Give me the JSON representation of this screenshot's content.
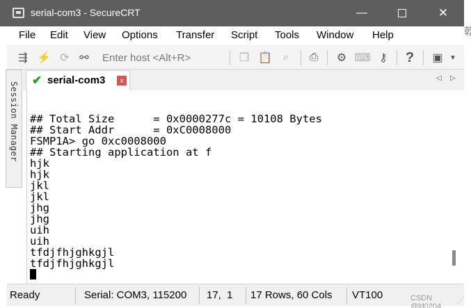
{
  "window": {
    "title": "serial-com3 - SecureCRT",
    "minimize_glyph": "—",
    "close_glyph": "✕"
  },
  "menu": [
    "File",
    "Edit",
    "View",
    "Options",
    "Transfer",
    "Script",
    "Tools",
    "Window",
    "Help"
  ],
  "toolbar": {
    "host_placeholder": "Enter host <Alt+R>",
    "icons": [
      "connect-icon",
      "quick-connect-icon",
      "reconnect-icon",
      "disconnect-icon",
      "copy-icon",
      "paste-icon",
      "find-icon",
      "print-icon",
      "settings-icon",
      "keymap-icon",
      "key-icon",
      "help-icon",
      "sftp-icon"
    ]
  },
  "session_manager": {
    "label": "Session Manager"
  },
  "tab": {
    "label": "serial-com3",
    "close_glyph": "x",
    "left_arrow": "◁",
    "right_arrow": "▷"
  },
  "terminal": {
    "lines": [
      "## Total Size      = 0x0000277c = 10108 Bytes",
      "## Start Addr      = 0xC0008000",
      "FSMP1A> go 0xc0008000",
      "## Starting application at f",
      "hjk",
      "hjk",
      "jkl",
      "jkl",
      "jhg",
      "jhg",
      "uih",
      "uih",
      "tfdjfhjghkgjl",
      "tfdjfhjghkgjl"
    ]
  },
  "status": {
    "state": "Ready",
    "connection": "Serial: COM3, 115200",
    "cursor_pos": "17,  1",
    "size": "17 Rows, 60 Cols",
    "emulation": "VT100",
    "watermark": "CSDN @ld0204"
  },
  "colors": {
    "titlebar": "#5e5e5e",
    "tab_check": "#1aa11a",
    "tab_close": "#d9534f"
  }
}
